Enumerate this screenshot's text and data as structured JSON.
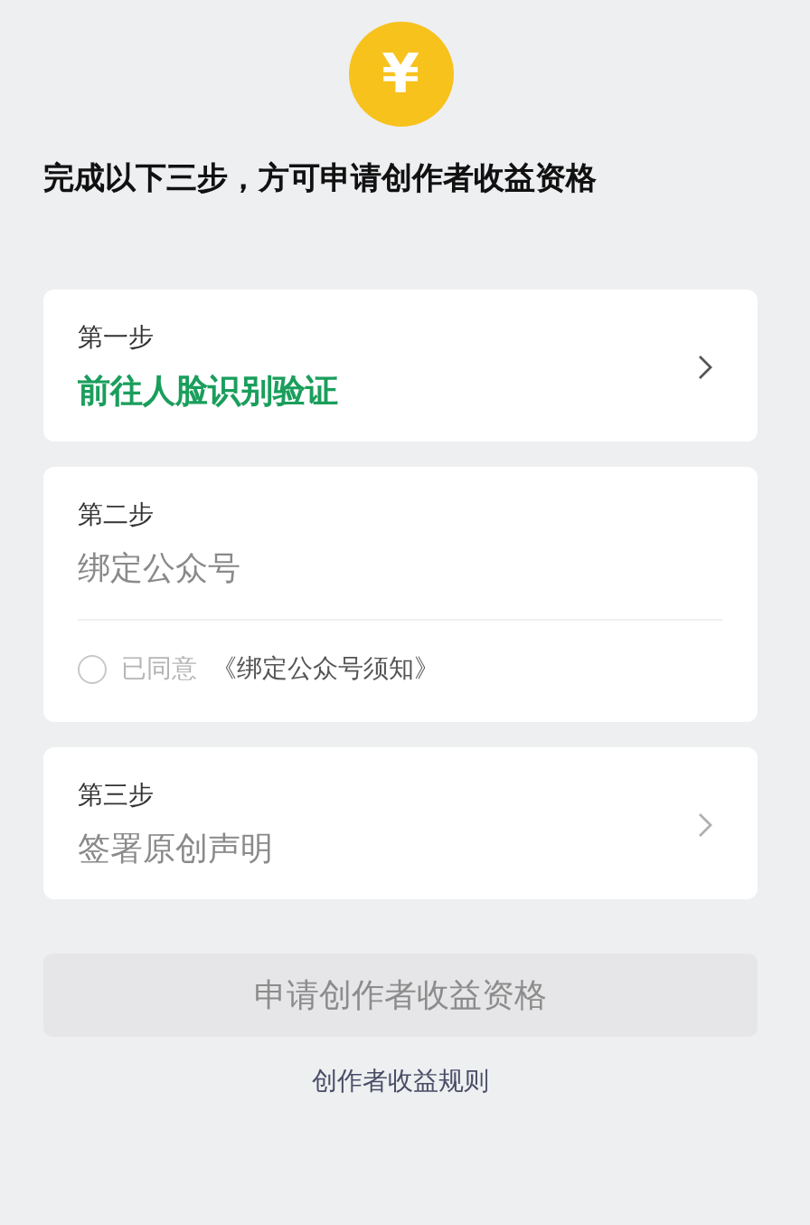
{
  "header": {
    "symbol": "¥",
    "title": "完成以下三步，方可申请创作者收益资格"
  },
  "steps": [
    {
      "kind": "link",
      "label": "第一步",
      "title": "前往人脸识别验证",
      "enabled": true
    },
    {
      "kind": "agreement",
      "label": "第二步",
      "title": "绑定公众号",
      "enabled": false,
      "agreement": {
        "checked": false,
        "prefix": "已同意",
        "document": "《绑定公众号须知》"
      }
    },
    {
      "kind": "link",
      "label": "第三步",
      "title": "签署原创声明",
      "enabled": false
    }
  ],
  "apply_button": {
    "label": "申请创作者收益资格",
    "disabled": true
  },
  "rules_link": "创作者收益规则"
}
